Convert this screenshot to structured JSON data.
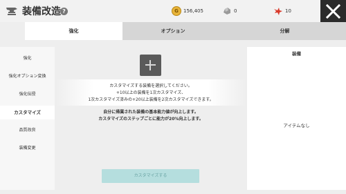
{
  "header": {
    "title": "装備改造",
    "help_icon": "question-circle-icon",
    "resources": [
      {
        "icon": "gold-coin-icon",
        "badge": "G",
        "value": "156,405"
      },
      {
        "icon": "silver-ore-icon",
        "value": "0"
      },
      {
        "icon": "red-bird-icon",
        "value": "10"
      }
    ],
    "close_icon": "close-x-icon"
  },
  "tabs": [
    {
      "label": "強化",
      "active": true
    },
    {
      "label": "オプション",
      "active": false
    },
    {
      "label": "分解",
      "active": false
    }
  ],
  "sidebar": {
    "items": [
      {
        "label": "強化",
        "active": false
      },
      {
        "label": "強化オプション変換",
        "active": false
      },
      {
        "label": "強化伝授",
        "active": false
      },
      {
        "label": "カスタマイズ",
        "active": true
      },
      {
        "label": "品質改良",
        "active": false
      },
      {
        "label": "装備変更",
        "active": false
      }
    ]
  },
  "main": {
    "add_icon": "plus-icon",
    "instructions": [
      "カスタマイズする装備を選択してください。",
      "+10以上の装備を1次カスタマイズ、",
      "1次カスタマイズ済みの+20以上装備を2次カスタマイズできます。"
    ],
    "notes": [
      "自分に帰属された装備の基本能力値が向上します。",
      "カスタマイズのステップごとに能力が20%向上します。"
    ],
    "customize_button": "カスタマイズする"
  },
  "equip_panel": {
    "title": "装備",
    "empty_text": "アイテムなし"
  },
  "colors": {
    "header_bg": "#f2f2f2",
    "close_bg": "#2b2b2b",
    "tab_bar_bg": "#d6d6d6",
    "button_bg": "#b5dede",
    "button_text": "#6aa4a4"
  }
}
